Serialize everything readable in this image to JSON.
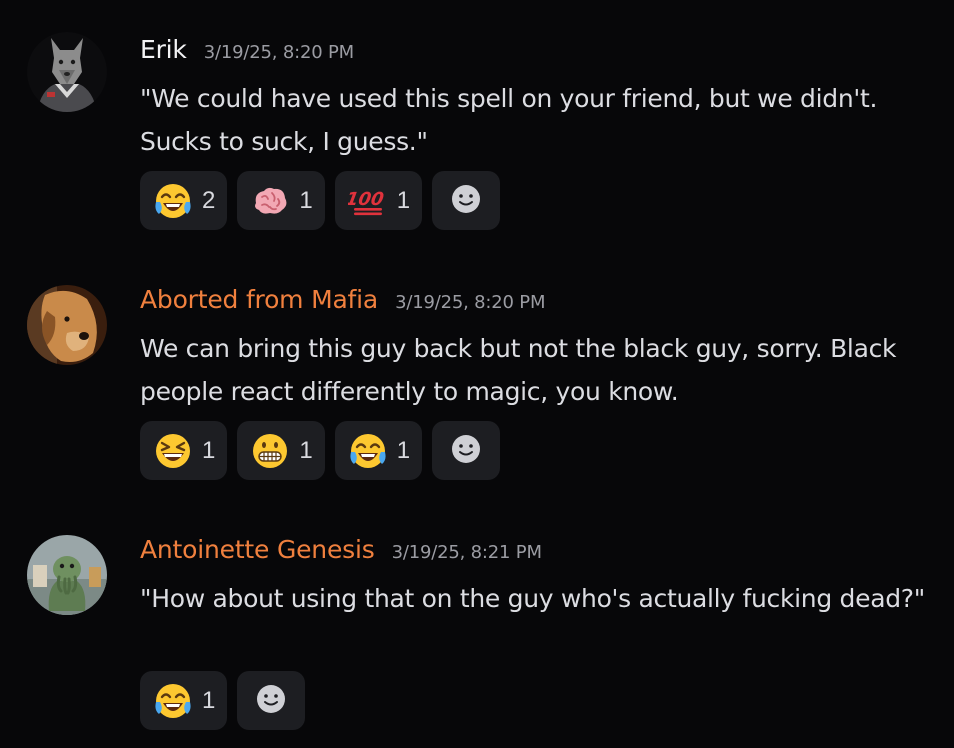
{
  "messages": [
    {
      "author": "Erik",
      "author_color": "#f3f3f5",
      "timestamp": "3/19/25, 8:20 PM",
      "content": "\"We could have used this spell on your friend, but we didn't. Sucks to suck, I guess.\"",
      "avatar_icon": "werewolf-avatar",
      "reactions": [
        {
          "emoji": "joy-emoji",
          "count": "2"
        },
        {
          "emoji": "brain-emoji",
          "count": "1"
        },
        {
          "emoji": "hundred-emoji",
          "count": "1"
        }
      ]
    },
    {
      "author": "Aborted from Mafia",
      "author_color": "#f0803e",
      "timestamp": "3/19/25, 8:20 PM",
      "content": "We can bring this guy back but not the black guy, sorry. Black people react differently to magic, you know.",
      "avatar_icon": "dog-avatar",
      "reactions": [
        {
          "emoji": "laughing-emoji",
          "count": "1"
        },
        {
          "emoji": "grimacing-emoji",
          "count": "1"
        },
        {
          "emoji": "joy-emoji",
          "count": "1"
        }
      ]
    },
    {
      "author": "Antoinette Genesis",
      "author_color": "#f0803e",
      "timestamp": "3/19/25, 8:21 PM",
      "content": "\"How about using that on the guy who's actually fucking dead?\"",
      "avatar_icon": "cthulhu-avatar",
      "reactions": [
        {
          "emoji": "joy-emoji",
          "count": "1"
        }
      ]
    }
  ],
  "add_reaction_icon": "add-reaction-smiley-icon"
}
